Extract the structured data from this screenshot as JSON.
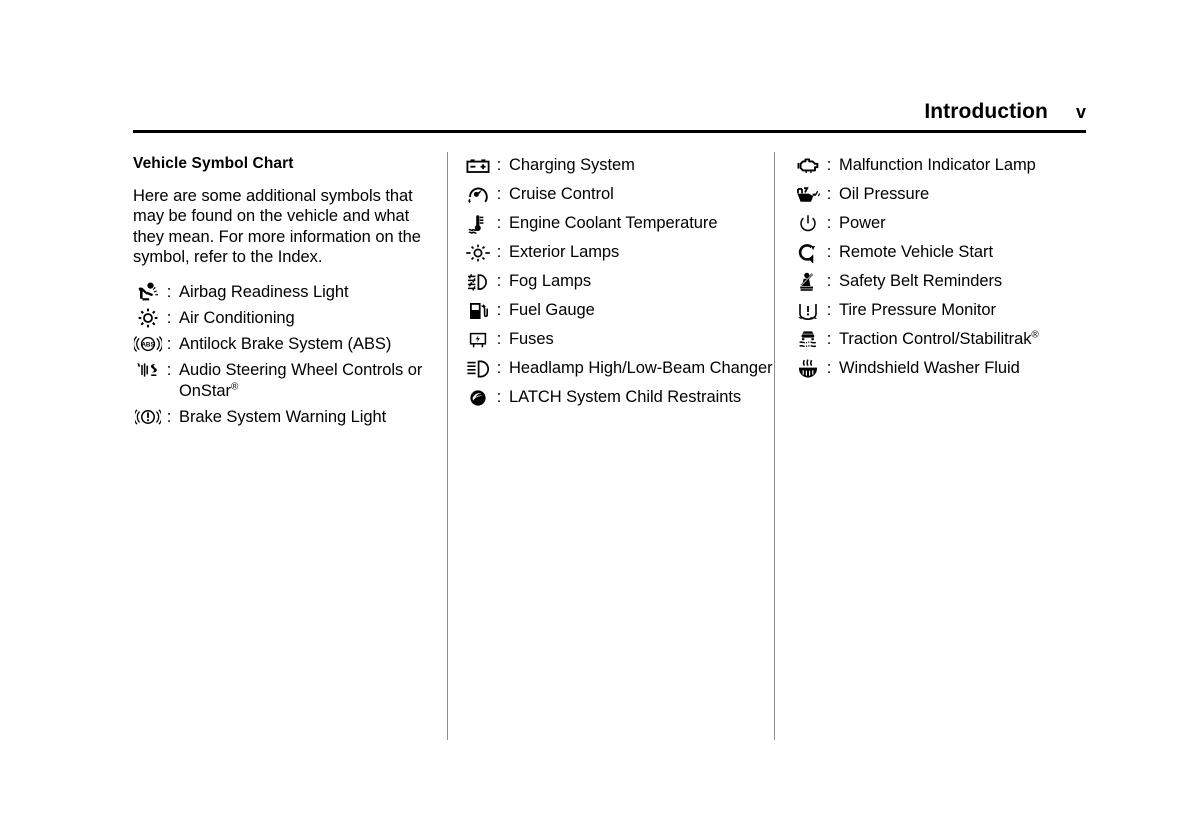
{
  "header": {
    "title": "Introduction",
    "page_number": "v"
  },
  "left_column": {
    "section_title": "Vehicle Symbol Chart",
    "intro_paragraph": "Here are some additional symbols that may be found on the vehicle and what they mean. For more information on the symbol, refer to the Index.",
    "separator": ":",
    "symbols": [
      {
        "icon": "airbag-readiness-icon",
        "label": "Airbag Readiness Light"
      },
      {
        "icon": "air-conditioning-icon",
        "label": "Air Conditioning"
      },
      {
        "icon": "abs-icon",
        "label": "Antilock Brake System (ABS)"
      },
      {
        "icon": "audio-steering-wheel-controls-icon",
        "label": "Audio Steering Wheel Controls or OnStar",
        "superscript": "®"
      },
      {
        "icon": "brake-system-warning-icon",
        "label": "Brake System Warning Light"
      }
    ]
  },
  "middle_column": {
    "separator": ":",
    "symbols": [
      {
        "icon": "charging-system-icon",
        "label": "Charging System"
      },
      {
        "icon": "cruise-control-icon",
        "label": "Cruise Control"
      },
      {
        "icon": "engine-coolant-temperature-icon",
        "label": "Engine Coolant Temperature"
      },
      {
        "icon": "exterior-lamps-icon",
        "label": "Exterior Lamps"
      },
      {
        "icon": "fog-lamps-icon",
        "label": "Fog Lamps"
      },
      {
        "icon": "fuel-gauge-icon",
        "label": "Fuel Gauge"
      },
      {
        "icon": "fuses-icon",
        "label": "Fuses"
      },
      {
        "icon": "headlamp-high-low-beam-icon",
        "label": "Headlamp High/Low-Beam Changer"
      },
      {
        "icon": "latch-child-restraints-icon",
        "label": "LATCH System Child Restraints"
      }
    ]
  },
  "right_column": {
    "separator": ":",
    "symbols": [
      {
        "icon": "malfunction-indicator-lamp-icon",
        "label": "Malfunction Indicator Lamp"
      },
      {
        "icon": "oil-pressure-icon",
        "label": "Oil Pressure"
      },
      {
        "icon": "power-icon",
        "label": "Power"
      },
      {
        "icon": "remote-vehicle-start-icon",
        "label": "Remote Vehicle Start"
      },
      {
        "icon": "safety-belt-reminders-icon",
        "label": "Safety Belt Reminders"
      },
      {
        "icon": "tire-pressure-monitor-icon",
        "label": "Tire Pressure Monitor"
      },
      {
        "icon": "traction-control-stabilitrak-icon",
        "label": "Traction Control/Stabilitrak",
        "superscript": "®"
      },
      {
        "icon": "windshield-washer-fluid-icon",
        "label": "Windshield Washer Fluid"
      }
    ]
  },
  "colors": {
    "text": "#000000",
    "background": "#ffffff",
    "rule": "#000000",
    "divider": "#8c8c8c"
  }
}
